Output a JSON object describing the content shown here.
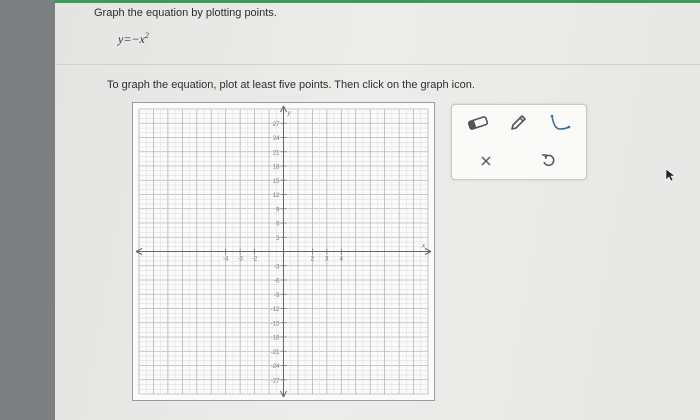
{
  "question": {
    "instruction": "Graph the equation by plotting points.",
    "equation_lhs": "y=−x",
    "equation_exp": "2",
    "prompt": "To graph the equation, plot at least five points. Then click on the graph icon."
  },
  "graph": {
    "x_axis_label": "x",
    "y_axis_label": "y",
    "x_min": -10,
    "x_max": 10,
    "y_min": -30,
    "y_max": 30,
    "x_tick_labels": [
      "-4",
      "-3",
      "-2",
      "2",
      "3",
      "4"
    ],
    "y_tick_labels": [
      "27",
      "24",
      "21",
      "18",
      "15",
      "12",
      "9",
      "6",
      "3",
      "-3",
      "-6",
      "-9",
      "-12",
      "-15",
      "-18",
      "-21",
      "-24",
      "-27"
    ]
  },
  "toolbar": {
    "tools": [
      {
        "name": "eraser-icon"
      },
      {
        "name": "pencil-icon"
      },
      {
        "name": "parabola-graph-icon"
      },
      {
        "name": "clear-x-icon"
      },
      {
        "name": "undo-icon"
      }
    ]
  },
  "colors": {
    "accent_strip": "#3a9d57",
    "tool_icon": "#555555"
  }
}
